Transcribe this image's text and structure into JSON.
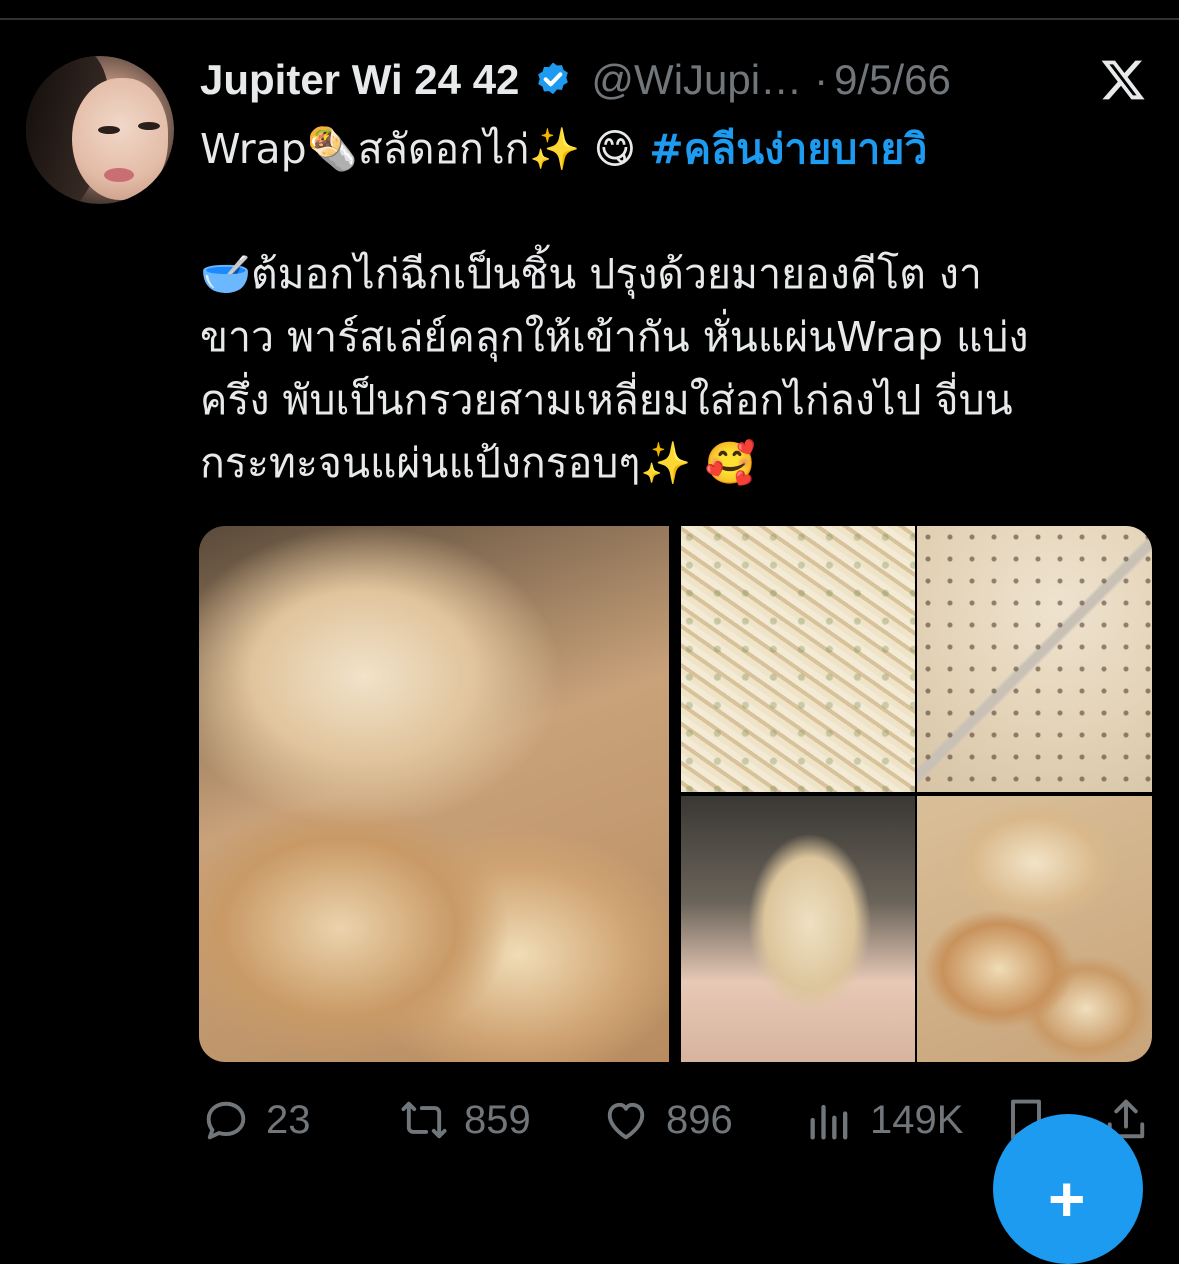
{
  "post": {
    "author_name": "Jupiter Wi 24 42",
    "handle": "@WiJupi…",
    "separator": "·",
    "date": "9/5/66",
    "text_lines": [
      "Wrap🌯สลัดอกไก่✨ 😋 ",
      "🥣ต้มอกไก่ฉีกเป็นชิ้น ปรุงด้วยมายองคีโต งา",
      "ขาว พาร์สเล่ย์คลุกให้เข้ากัน หั่นแผ่นWrap แบ่ง",
      "ครึ่ง พับเป็นกรวยสามเหลี่ยมใส่อกไก่ลงไป จี่บน",
      "กระทะจนแผ่นแป้งกรอบๆ✨ 🥰"
    ],
    "hashtag": "#คลีนง่ายบายวิ"
  },
  "actions": {
    "replies": "23",
    "reposts": "859",
    "likes": "896",
    "views": "149K"
  },
  "fab_symbol": "+",
  "icons": [
    "verified-badge-icon",
    "x-logo-icon",
    "reply-icon",
    "repost-icon",
    "like-icon",
    "views-icon",
    "bookmark-icon",
    "share-icon"
  ],
  "colors": {
    "background": "#000000",
    "text": "#e7e9ea",
    "secondary": "#71767b",
    "accent": "#1d9bf0"
  }
}
